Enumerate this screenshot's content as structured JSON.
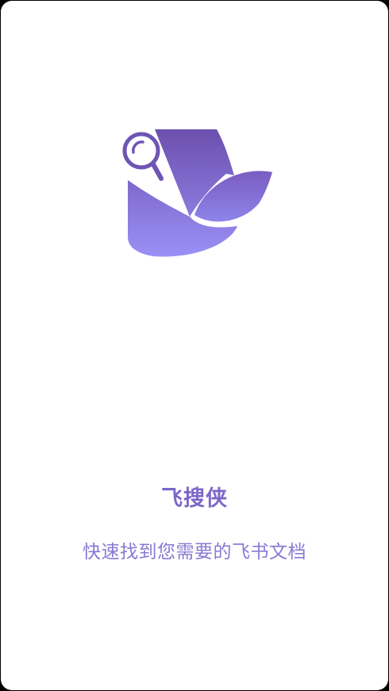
{
  "splash": {
    "app_name": "飞搜侠",
    "tagline": "快速找到您需要的飞书文档",
    "logo_icon": "feisouxia-logo-icon"
  },
  "colors": {
    "background": "#ffffff",
    "accent_dark": "#6a4fb0",
    "accent_light": "#9b8cf0",
    "text": "#7b67c8"
  }
}
